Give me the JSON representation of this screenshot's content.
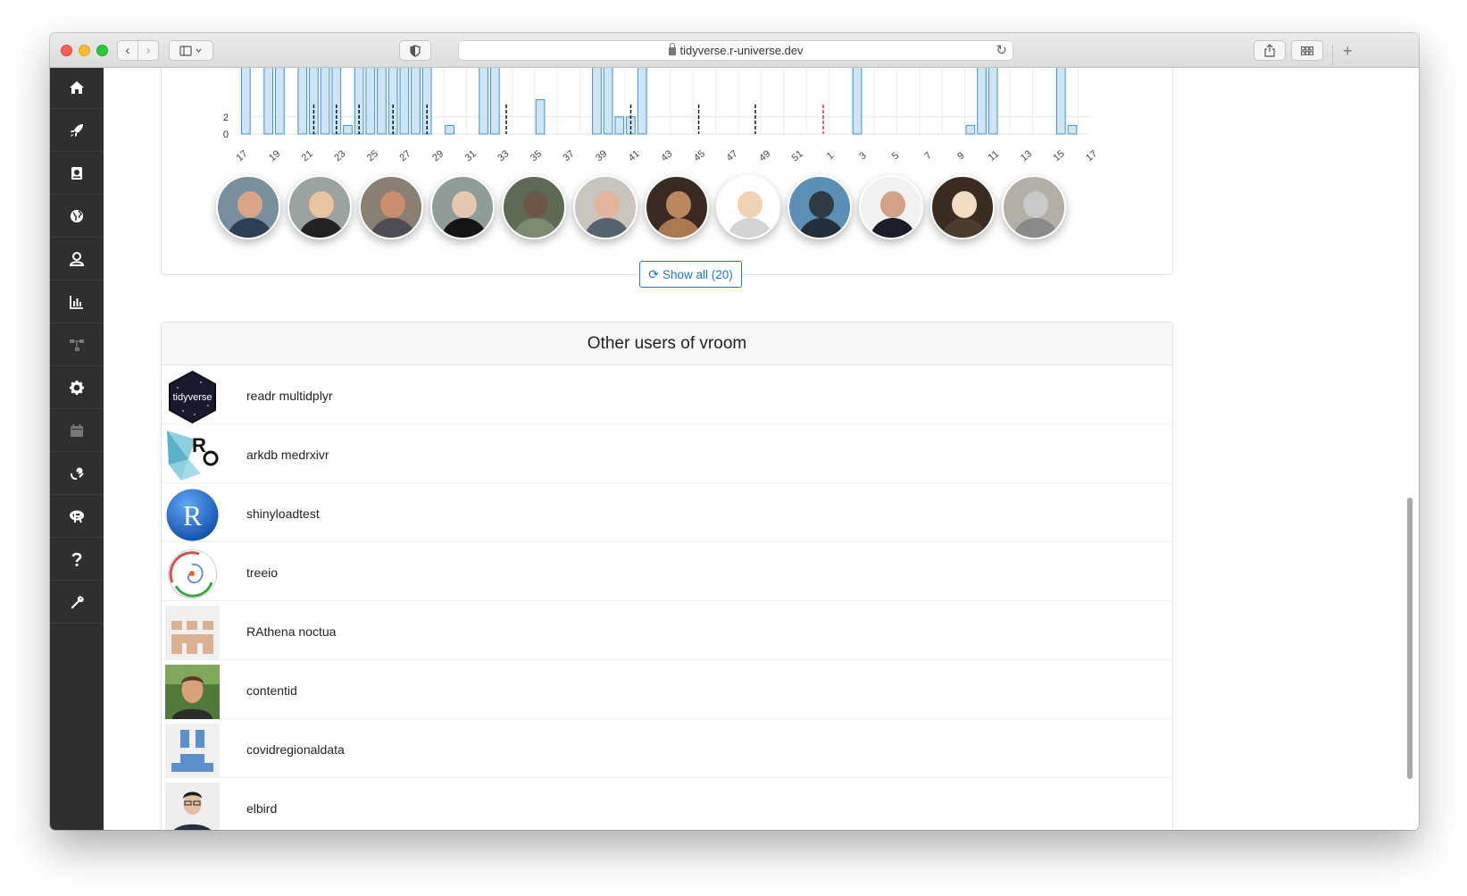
{
  "browser": {
    "url": "tidyverse.r-universe.dev"
  },
  "sidebar": {
    "items": [
      {
        "icon": "home-icon",
        "color": "#ffffff"
      },
      {
        "icon": "rocket-icon",
        "color": "#ffffff"
      },
      {
        "icon": "book-icon",
        "color": "#ffffff"
      },
      {
        "icon": "globe-icon",
        "color": "#ffffff"
      },
      {
        "icon": "user-icon",
        "color": "#ffffff"
      },
      {
        "icon": "bar-chart-icon",
        "color": "#ffffff"
      },
      {
        "icon": "sitemap-icon",
        "color": "#777777"
      },
      {
        "icon": "gear-icon",
        "color": "#ffffff"
      },
      {
        "icon": "calendar-icon",
        "color": "#777777"
      },
      {
        "icon": "satellite-icon",
        "color": "#ffffff"
      },
      {
        "icon": "r-logo-icon",
        "color": "#ffffff"
      },
      {
        "icon": "question-icon",
        "color": "#ffffff"
      },
      {
        "icon": "wrench-icon",
        "color": "#ffffff"
      }
    ]
  },
  "chart_data": {
    "type": "bar",
    "y_tick_labels": [
      "0",
      "2"
    ],
    "x_tick_labels": [
      "17",
      "19",
      "21",
      "23",
      "25",
      "27",
      "29",
      "31",
      "33",
      "35",
      "37",
      "39",
      "41",
      "43",
      "45",
      "47",
      "49",
      "51",
      "1",
      "3",
      "5",
      "7",
      "9",
      "11",
      "13",
      "15",
      "17"
    ],
    "values": [
      10,
      0,
      10,
      10,
      0,
      10,
      10,
      10,
      10,
      1,
      10,
      10,
      10,
      10,
      10,
      10,
      10,
      0,
      1,
      0,
      0,
      10,
      10,
      0,
      0,
      0,
      4,
      0,
      0,
      0,
      0,
      10,
      10,
      2,
      2,
      10,
      0,
      0,
      0,
      0,
      0,
      0,
      0,
      0,
      0,
      0,
      0,
      0,
      0,
      0,
      0,
      0,
      0,
      0,
      10,
      0,
      0,
      0,
      0,
      0,
      0,
      0,
      0,
      0,
      1,
      10,
      10,
      0,
      0,
      0,
      0,
      0,
      10,
      1,
      0
    ],
    "markers": [
      {
        "index": 6,
        "color": "#000000"
      },
      {
        "index": 8,
        "color": "#000000"
      },
      {
        "index": 10,
        "color": "#000000"
      },
      {
        "index": 13,
        "color": "#000000"
      },
      {
        "index": 16,
        "color": "#000000"
      },
      {
        "index": 23,
        "color": "#000000"
      },
      {
        "index": 34,
        "color": "#000000"
      },
      {
        "index": 40,
        "color": "#000000"
      },
      {
        "index": 45,
        "color": "#000000"
      },
      {
        "index": 51,
        "color": "#d62d2d"
      }
    ],
    "bar_color": "#cfe5f5",
    "bar_edge": "#3c93d2"
  },
  "contributors": [
    {
      "face": "#d9a487",
      "body": "#2f3f55",
      "bg": "#7a8f9e"
    },
    {
      "face": "#e9c49c",
      "body": "#222222",
      "bg": "#9aa3a0"
    },
    {
      "face": "#c88e6d",
      "body": "#4d4d56",
      "bg": "#8b7e72"
    },
    {
      "face": "#e6c7b0",
      "body": "#151515",
      "bg": "#8e9c9a"
    },
    {
      "face": "#6c5746",
      "body": "#7c8a6e",
      "bg": "#5f6a55"
    },
    {
      "face": "#e3b49c",
      "body": "#55626f",
      "bg": "#c9c4be"
    },
    {
      "face": "#b9895d",
      "body": "#a97a4f",
      "bg": "#3a2a21"
    },
    {
      "face": "#f1d3b2",
      "body": "#d4d4d4",
      "bg": "#ffffff"
    },
    {
      "face": "#2f3a42",
      "body": "#21303b",
      "bg": "#5c8fb5"
    },
    {
      "face": "#d3a283",
      "body": "#1b1f2a",
      "bg": "#f2f2f2"
    },
    {
      "face": "#f0dcc2",
      "body": "#4c3c2e",
      "bg": "#3a2c20"
    },
    {
      "face": "#c9c9c9",
      "body": "#8a8a8a",
      "bg": "#b3aea6"
    }
  ],
  "show_all": {
    "label": "Show all (20)",
    "icon": "refresh-icon"
  },
  "users": {
    "title": "Other users of vroom",
    "rows": [
      {
        "name": "readr multidplyr",
        "logo": "tidyverse-logo",
        "logo_text": "tidyverse"
      },
      {
        "name": "arkdb medrxivr",
        "logo": "ropensci-logo"
      },
      {
        "name": "shinyloadtest",
        "logo": "r-logo",
        "logo_text": "R"
      },
      {
        "name": "treeio",
        "logo": "treeio-logo"
      },
      {
        "name": "RAthena noctua",
        "logo": "identicon-orange"
      },
      {
        "name": "contentid",
        "logo": "person-avatar"
      },
      {
        "name": "covidregionaldata",
        "logo": "identicon-blue"
      },
      {
        "name": "elbird",
        "logo": "person-avatar-2"
      }
    ]
  }
}
